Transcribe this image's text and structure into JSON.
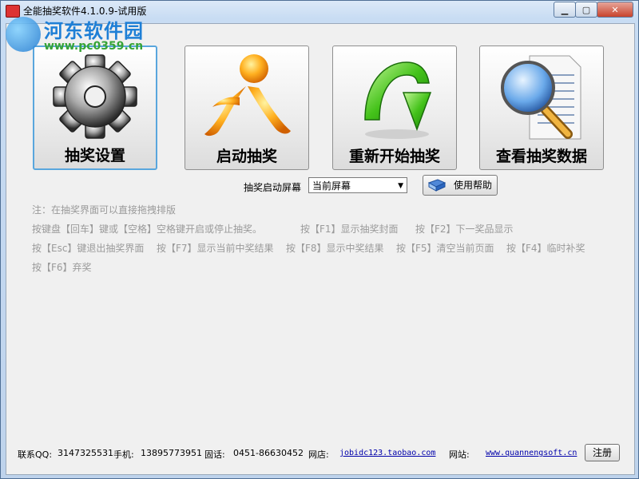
{
  "window": {
    "title": "全能抽奖软件4.1.0.9-试用版",
    "controls": {
      "minimize": "▁",
      "maximize": "▢",
      "close": "✕"
    }
  },
  "watermark": {
    "name": "河东软件园",
    "url": "www.pc0359.cn"
  },
  "main_buttons": [
    {
      "label": "抽奖设置",
      "icon": "gear-icon"
    },
    {
      "label": "启动抽奖",
      "icon": "running-person-icon"
    },
    {
      "label": "重新开始抽奖",
      "icon": "green-arrow-icon"
    },
    {
      "label": "查看抽奖数据",
      "icon": "magnifier-document-icon"
    }
  ],
  "screen": {
    "label": "抽奖启动屏幕",
    "selected": "当前屏幕",
    "help_label": "使用帮助"
  },
  "notes": [
    "注：在抽奖界面可以直接拖拽排版",
    "按键盘【回车】键或【空格】空格键开启或停止抽奖。",
    "按【F1】显示抽奖封面",
    "按【F2】下一奖品显示",
    "按【Esc】键退出抽奖界面",
    "按【F7】显示当前中奖结果",
    "按【F8】显示中奖结果",
    "按【F5】清空当前页面",
    "按【F4】临时补奖",
    "按【F6】弃奖"
  ],
  "footer": {
    "qq_label": "联系QQ:",
    "qq": "3147325531",
    "phone_label": "手机:",
    "phone": "13895773951",
    "tel_label": "固话:",
    "tel": "0451-86630452",
    "shop_label": "网店:",
    "shop_url": "jobidc123.taobao.com",
    "site_label": "网站:",
    "site_url": "www.quannengsoft.cn",
    "register_label": "注册"
  },
  "colors": {
    "selected_border": "#59a6dd",
    "note_text": "#9a9a9a",
    "link": "#0000aa"
  }
}
